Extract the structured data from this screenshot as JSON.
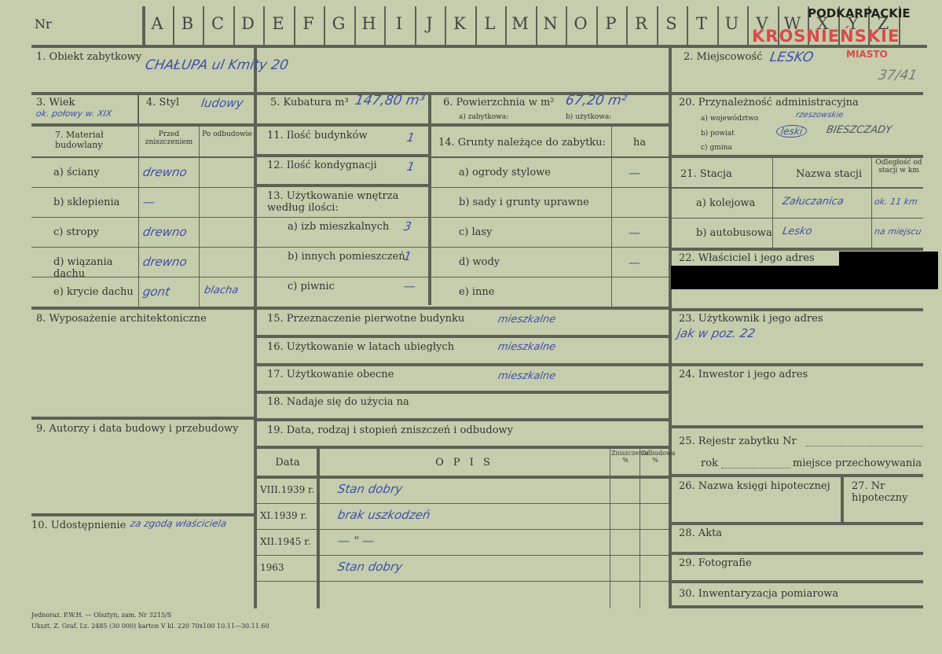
{
  "header": {
    "nr_label": "Nr",
    "letters": [
      "A",
      "B",
      "C",
      "D",
      "E",
      "F",
      "G",
      "H",
      "I",
      "J",
      "K",
      "L",
      "M",
      "N",
      "O",
      "P",
      "R",
      "S",
      "T",
      "U",
      "V",
      "W",
      "X",
      "Y",
      "Z"
    ],
    "stamp_region": "PODKARPACKIE",
    "stamp_district": "KROSNIEŃSKIE",
    "stamp_city": "MIASTO",
    "registry_number": "37/41"
  },
  "f1": {
    "label": "1. Obiekt zabytkowy",
    "value": "CHAŁUPA ul Kmity 20"
  },
  "f2": {
    "label": "2. Miejscowość",
    "value": "LESKO"
  },
  "f3": {
    "label": "3. Wiek",
    "value": "ok. połowy w. XIX"
  },
  "f4": {
    "label": "4. Styl",
    "value": "ludowy"
  },
  "f5": {
    "label": "5. Kubatura m³",
    "value": "147,80 m³"
  },
  "f6": {
    "label": "6. Powierzchnia w m²",
    "value": "67,20 m²",
    "sub_a": "a) zabytkowa:",
    "sub_b": "b) użytkowa:"
  },
  "f7": {
    "label": "7. Materiał budowlany",
    "col_before": "Przed zniszczeniem",
    "col_after": "Po odbudowie",
    "rows": [
      {
        "label": "a) ściany",
        "before": "drewno",
        "after": ""
      },
      {
        "label": "b) sklepienia",
        "before": "—",
        "after": ""
      },
      {
        "label": "c) stropy",
        "before": "drewno",
        "after": ""
      },
      {
        "label": "d) wiązania dachu",
        "before": "drewno",
        "after": ""
      },
      {
        "label": "e) krycie dachu",
        "before": "gont",
        "after": "blacha"
      }
    ]
  },
  "f8": {
    "label": "8. Wyposażenie architektoniczne"
  },
  "f9": {
    "label": "9. Autorzy i data budowy i przebudowy"
  },
  "f10": {
    "label": "10. Udostępnienie",
    "value": "za zgodą właściciela"
  },
  "f11": {
    "label": "11. Ilość budynków",
    "value": "1"
  },
  "f12": {
    "label": "12. Ilość kondygnacji",
    "value": "1"
  },
  "f13": {
    "label": "13. Użytkowanie wnętrza według ilości:",
    "rows": [
      {
        "label": "a) izb mieszkalnych",
        "value": "3"
      },
      {
        "label": "b) innych pomieszczeń",
        "value": "1"
      },
      {
        "label": "c) piwnic",
        "value": "—"
      }
    ]
  },
  "f14": {
    "label": "14. Grunty należące do zabytku:",
    "unit": "ha",
    "rows": [
      {
        "label": "a) ogrody stylowe",
        "value": "—"
      },
      {
        "label": "b) sady i grunty uprawne",
        "value": ""
      },
      {
        "label": "c) lasy",
        "value": "—"
      },
      {
        "label": "d) wody",
        "value": "—"
      },
      {
        "label": "e) inne",
        "value": ""
      }
    ]
  },
  "f15": {
    "label": "15. Przeznaczenie pierwotne budynku",
    "value": "mieszkalne"
  },
  "f16": {
    "label": "16. Użytkowanie w latach ubiegłych",
    "value": "mieszkalne"
  },
  "f17": {
    "label": "17. Użytkowanie obecne",
    "value": "mieszkalne"
  },
  "f18": {
    "label": "18. Nadaje się do użycia na"
  },
  "f19": {
    "label": "19. Data, rodzaj i stopień zniszczeń i odbudowy",
    "col_date": "Data",
    "col_desc": "O P I S",
    "col_damage": "Zniszczenia %",
    "col_rebuild": "Odbudowa %",
    "rows": [
      {
        "date": "VIII.1939 r.",
        "desc": "Stan dobry"
      },
      {
        "date": "XI.1939 r.",
        "desc": "brak uszkodzeń"
      },
      {
        "date": "XII.1945 r.",
        "desc": "— \" —"
      },
      {
        "date": "1963",
        "desc": "Stan dobry"
      }
    ]
  },
  "f20": {
    "label": "20. Przynależność administracyjna",
    "a_label": "a) województwo",
    "a_value": "rzeszowskie",
    "b_label": "b) powiat",
    "b_value": "leski",
    "b_extra": "BIESZCZADY",
    "c_label": "c) gmina"
  },
  "f21": {
    "label": "21. Stacja",
    "col_name": "Nazwa stacji",
    "col_dist": "Odległość od stacji w km",
    "rows": [
      {
        "label": "a) kolejowa",
        "name": "Załuczanica",
        "dist": "ok. 11 km"
      },
      {
        "label": "b) autobusowa",
        "name": "Lesko",
        "dist": "na miejscu"
      }
    ]
  },
  "f22": {
    "label": "22. Właściciel i jego adres"
  },
  "f23": {
    "label": "23. Użytkownik i jego adres",
    "value": "jak w poz. 22"
  },
  "f24": {
    "label": "24. Inwestor i jego adres"
  },
  "f25": {
    "label": "25. Rejestr zabytku Nr",
    "rok": "rok",
    "miejsce": "miejsce przechowywania"
  },
  "f26": {
    "label": "26. Nazwa księgi hipotecznej"
  },
  "f27": {
    "label": "27. Nr hipoteczny"
  },
  "f28": {
    "label": "28. Akta"
  },
  "f29": {
    "label": "29. Fotografie"
  },
  "f30": {
    "label": "30. Inwentaryzacja pomiarowa"
  },
  "footer": {
    "line1": "Jednoraz. P.W.H. — Olsztyn, zam. Nr 3215/S",
    "line2": "Ukszt. Z. Graf. Lz. 2485 (30 000) karton V kl. 220 70x100 10.11—30.11.60"
  },
  "colors": {
    "paper": "#c6cdac",
    "rule": "#5d6155",
    "ink": "#3d4fa8",
    "stamp_red": "#d94a4a",
    "redaction": "#000000"
  }
}
